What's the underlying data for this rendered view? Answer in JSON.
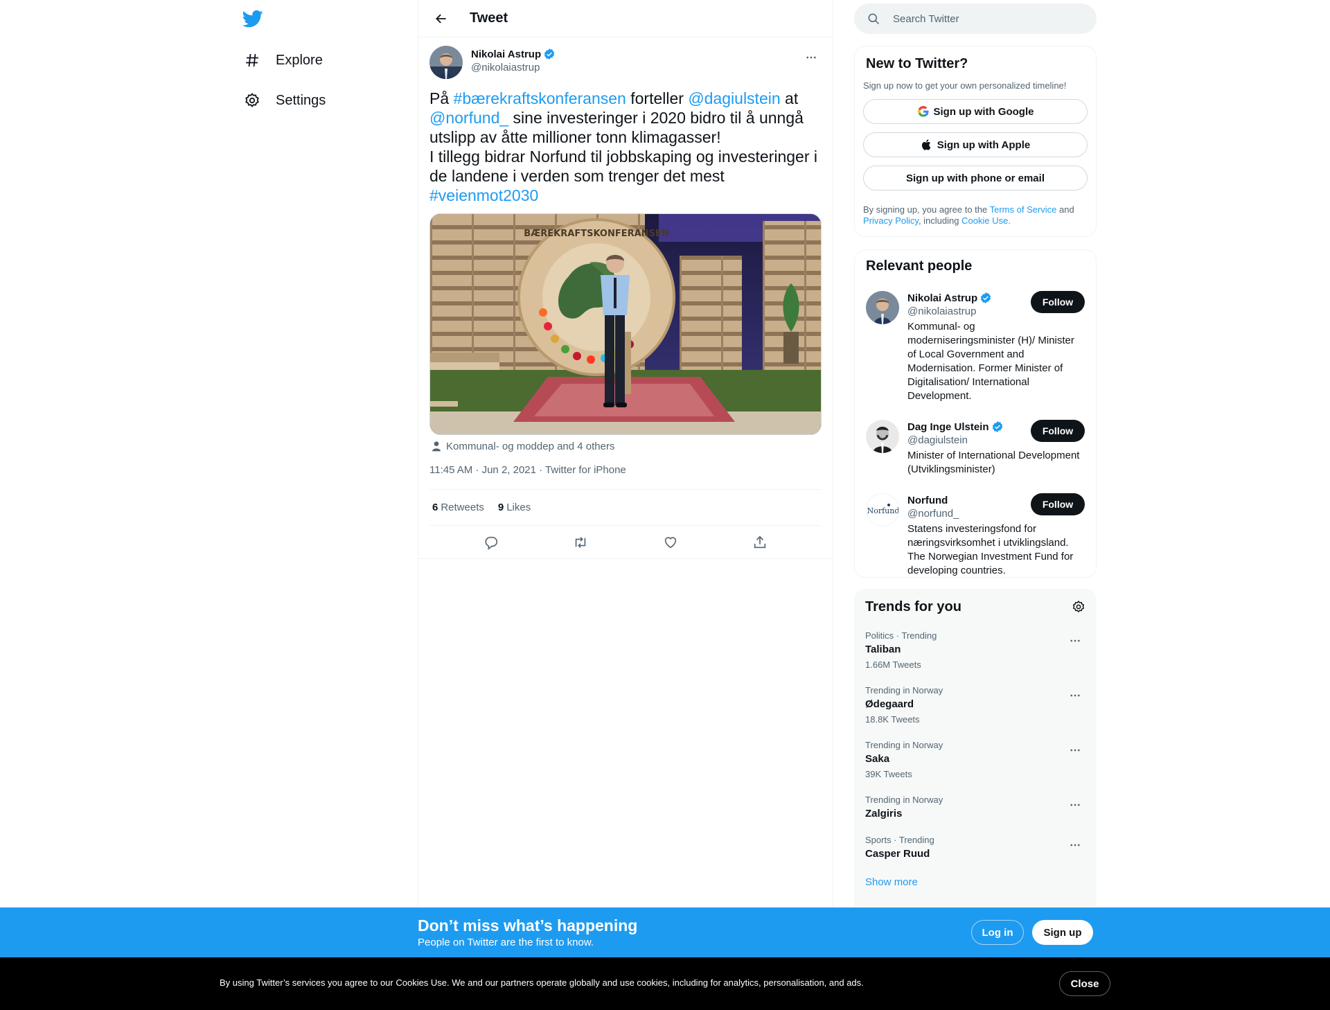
{
  "nav": {
    "logo_icon": "twitter-bird-icon",
    "items": [
      {
        "label": "Explore",
        "icon": "hash-icon"
      },
      {
        "label": "Settings",
        "icon": "gear-icon"
      }
    ]
  },
  "header": {
    "title": "Tweet"
  },
  "tweet": {
    "author_name": "Nikolai Astrup",
    "author_handle": "@nikolaiastrup",
    "text": {
      "t1": "På ",
      "l1": "#bærekraftskonferansen",
      "t2": " forteller ",
      "l2": "@dagiulstein",
      "t3": " at ",
      "l3": "@norfund_",
      "t4": " sine investeringer i 2020 bidro til å unngå utslipp av åtte millioner tonn klimagasser!",
      "t5": "I tillegg bidrar Norfund til jobbskaping og investeringer i de landene i verden som trenger det mest",
      "l4": "#veienmot2030"
    },
    "image_sign_text": "BÆREKRAFTSKONFERANSEN",
    "tagged": "Kommunal- og moddep and 4 others",
    "timestamp": "11:45 AM · Jun 2, 2021 · Twitter for iPhone",
    "retweets_count": "6",
    "retweets_label": "Retweets",
    "likes_count": "9",
    "likes_label": "Likes"
  },
  "search": {
    "placeholder": "Search Twitter"
  },
  "signup": {
    "title": "New to Twitter?",
    "subtitle": "Sign up now to get your own personalized timeline!",
    "google": "Sign up with Google",
    "apple": "Sign up with Apple",
    "phone": "Sign up with phone or email",
    "legal_1": "By signing up, you agree to the ",
    "terms": "Terms of Service",
    "legal_2": " and ",
    "privacy": "Privacy Policy",
    "legal_3": ", including ",
    "cookie": "Cookie Use."
  },
  "people": {
    "title": "Relevant people",
    "follow_label": "Follow",
    "list": [
      {
        "name": "Nikolai Astrup",
        "handle": "@nikolaiastrup",
        "verified": true,
        "bio": "Kommunal- og moderniseringsminister (H)/ Minister of Local Government and Modernisation. Former Minister of Digitalisation/ International Development."
      },
      {
        "name": "Dag Inge Ulstein",
        "handle": "@dagiulstein",
        "verified": true,
        "bio": "Minister of International Development (Utviklingsminister)"
      },
      {
        "name": "Norfund",
        "handle": "@norfund_",
        "verified": false,
        "avatar_text": "Norfund",
        "bio": "Statens investeringsfond for næringsvirksomhet i utviklingsland. The Norwegian Investment Fund for developing countries."
      }
    ]
  },
  "trends": {
    "title": "Trends for you",
    "items": [
      {
        "meta": "Politics · Trending",
        "name": "Taliban",
        "count": "1.66M Tweets"
      },
      {
        "meta": "Trending in Norway",
        "name": "Ødegaard",
        "count": "18.8K Tweets"
      },
      {
        "meta": "Trending in Norway",
        "name": "Saka",
        "count": "39K Tweets"
      },
      {
        "meta": "Trending in Norway",
        "name": "Zalgiris",
        "count": ""
      },
      {
        "meta": "Sports · Trending",
        "name": "Casper Ruud",
        "count": ""
      }
    ],
    "show_more": "Show more"
  },
  "banner": {
    "title": "Don’t miss what’s happening",
    "subtitle": "People on Twitter are the first to know.",
    "login": "Log in",
    "signup": "Sign up"
  },
  "cookie_bar": {
    "text": "By using Twitter’s services you agree to our Cookies Use. We and our partners operate globally and use cookies, including for analytics, personalisation, and ads.",
    "close": "Close"
  },
  "colors": {
    "accent": "#1d9bf0",
    "text": "#0f1419",
    "muted": "#536471",
    "border": "#eff3f4",
    "dark_button": "#0f1419"
  }
}
